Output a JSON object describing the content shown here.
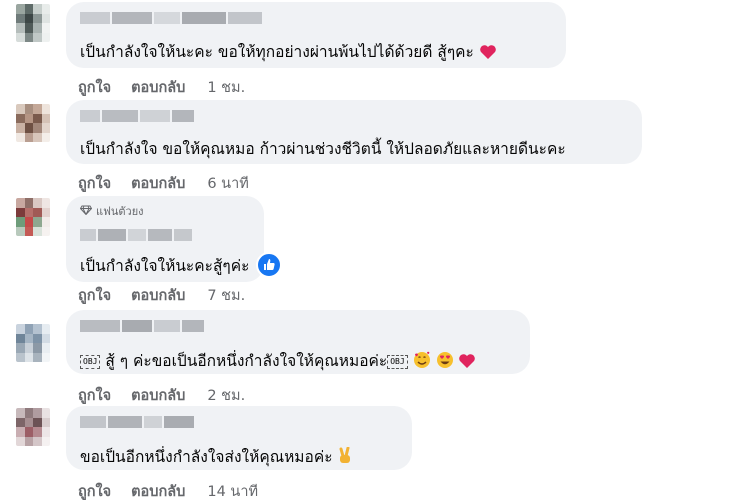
{
  "comments": [
    {
      "text": "เป็นกำลังใจให้นะคะ ขอให้ทุกอย่างผ่านพ้นไปได้ด้วยดี สู้ๆคะ",
      "like": "ถูกใจ",
      "reply": "ตอบกลับ",
      "time": "1 ชม.",
      "emoji": "red-heart"
    },
    {
      "text": "เป็นกำลังใจ ขอให้คุณหมอ ก้าวผ่านช่วงชีวิตนี้ ให้ปลอดภัยและหายดีนะคะ",
      "like": "ถูกใจ",
      "reply": "ตอบกลับ",
      "time": "6 นาที"
    },
    {
      "badge": "แฟนตัวยง",
      "text": "เป็นกำลังใจให้นะคะสู้ๆค่ะ",
      "like": "ถูกใจ",
      "reply": "ตอบกลับ",
      "time": "7 ชม.",
      "reaction": "like"
    },
    {
      "obj_label": "OBJ",
      "text_a": " สู้ ๆ ค่ะขอเป็นอีกหนึ่งกำลังใจให้คุณหมอค่ะ",
      "like": "ถูกใจ",
      "reply": "ตอบกลับ",
      "time": "2 ชม.",
      "emojis": [
        "smiling-face-with-hearts",
        "heart-eyes",
        "red-heart"
      ]
    },
    {
      "text": "ขอเป็นอีกหนึ่งกำลังใจส่งให้คุณหมอค่ะ",
      "like": "ถูกใจ",
      "reply": "ตอบกลับ",
      "time": "14 นาที",
      "emoji": "victory-hand"
    }
  ],
  "colors": {
    "bubble": "#f0f2f5",
    "action": "#65676b",
    "like_blue": "#1877f2",
    "heart_red": "#e0245e"
  }
}
